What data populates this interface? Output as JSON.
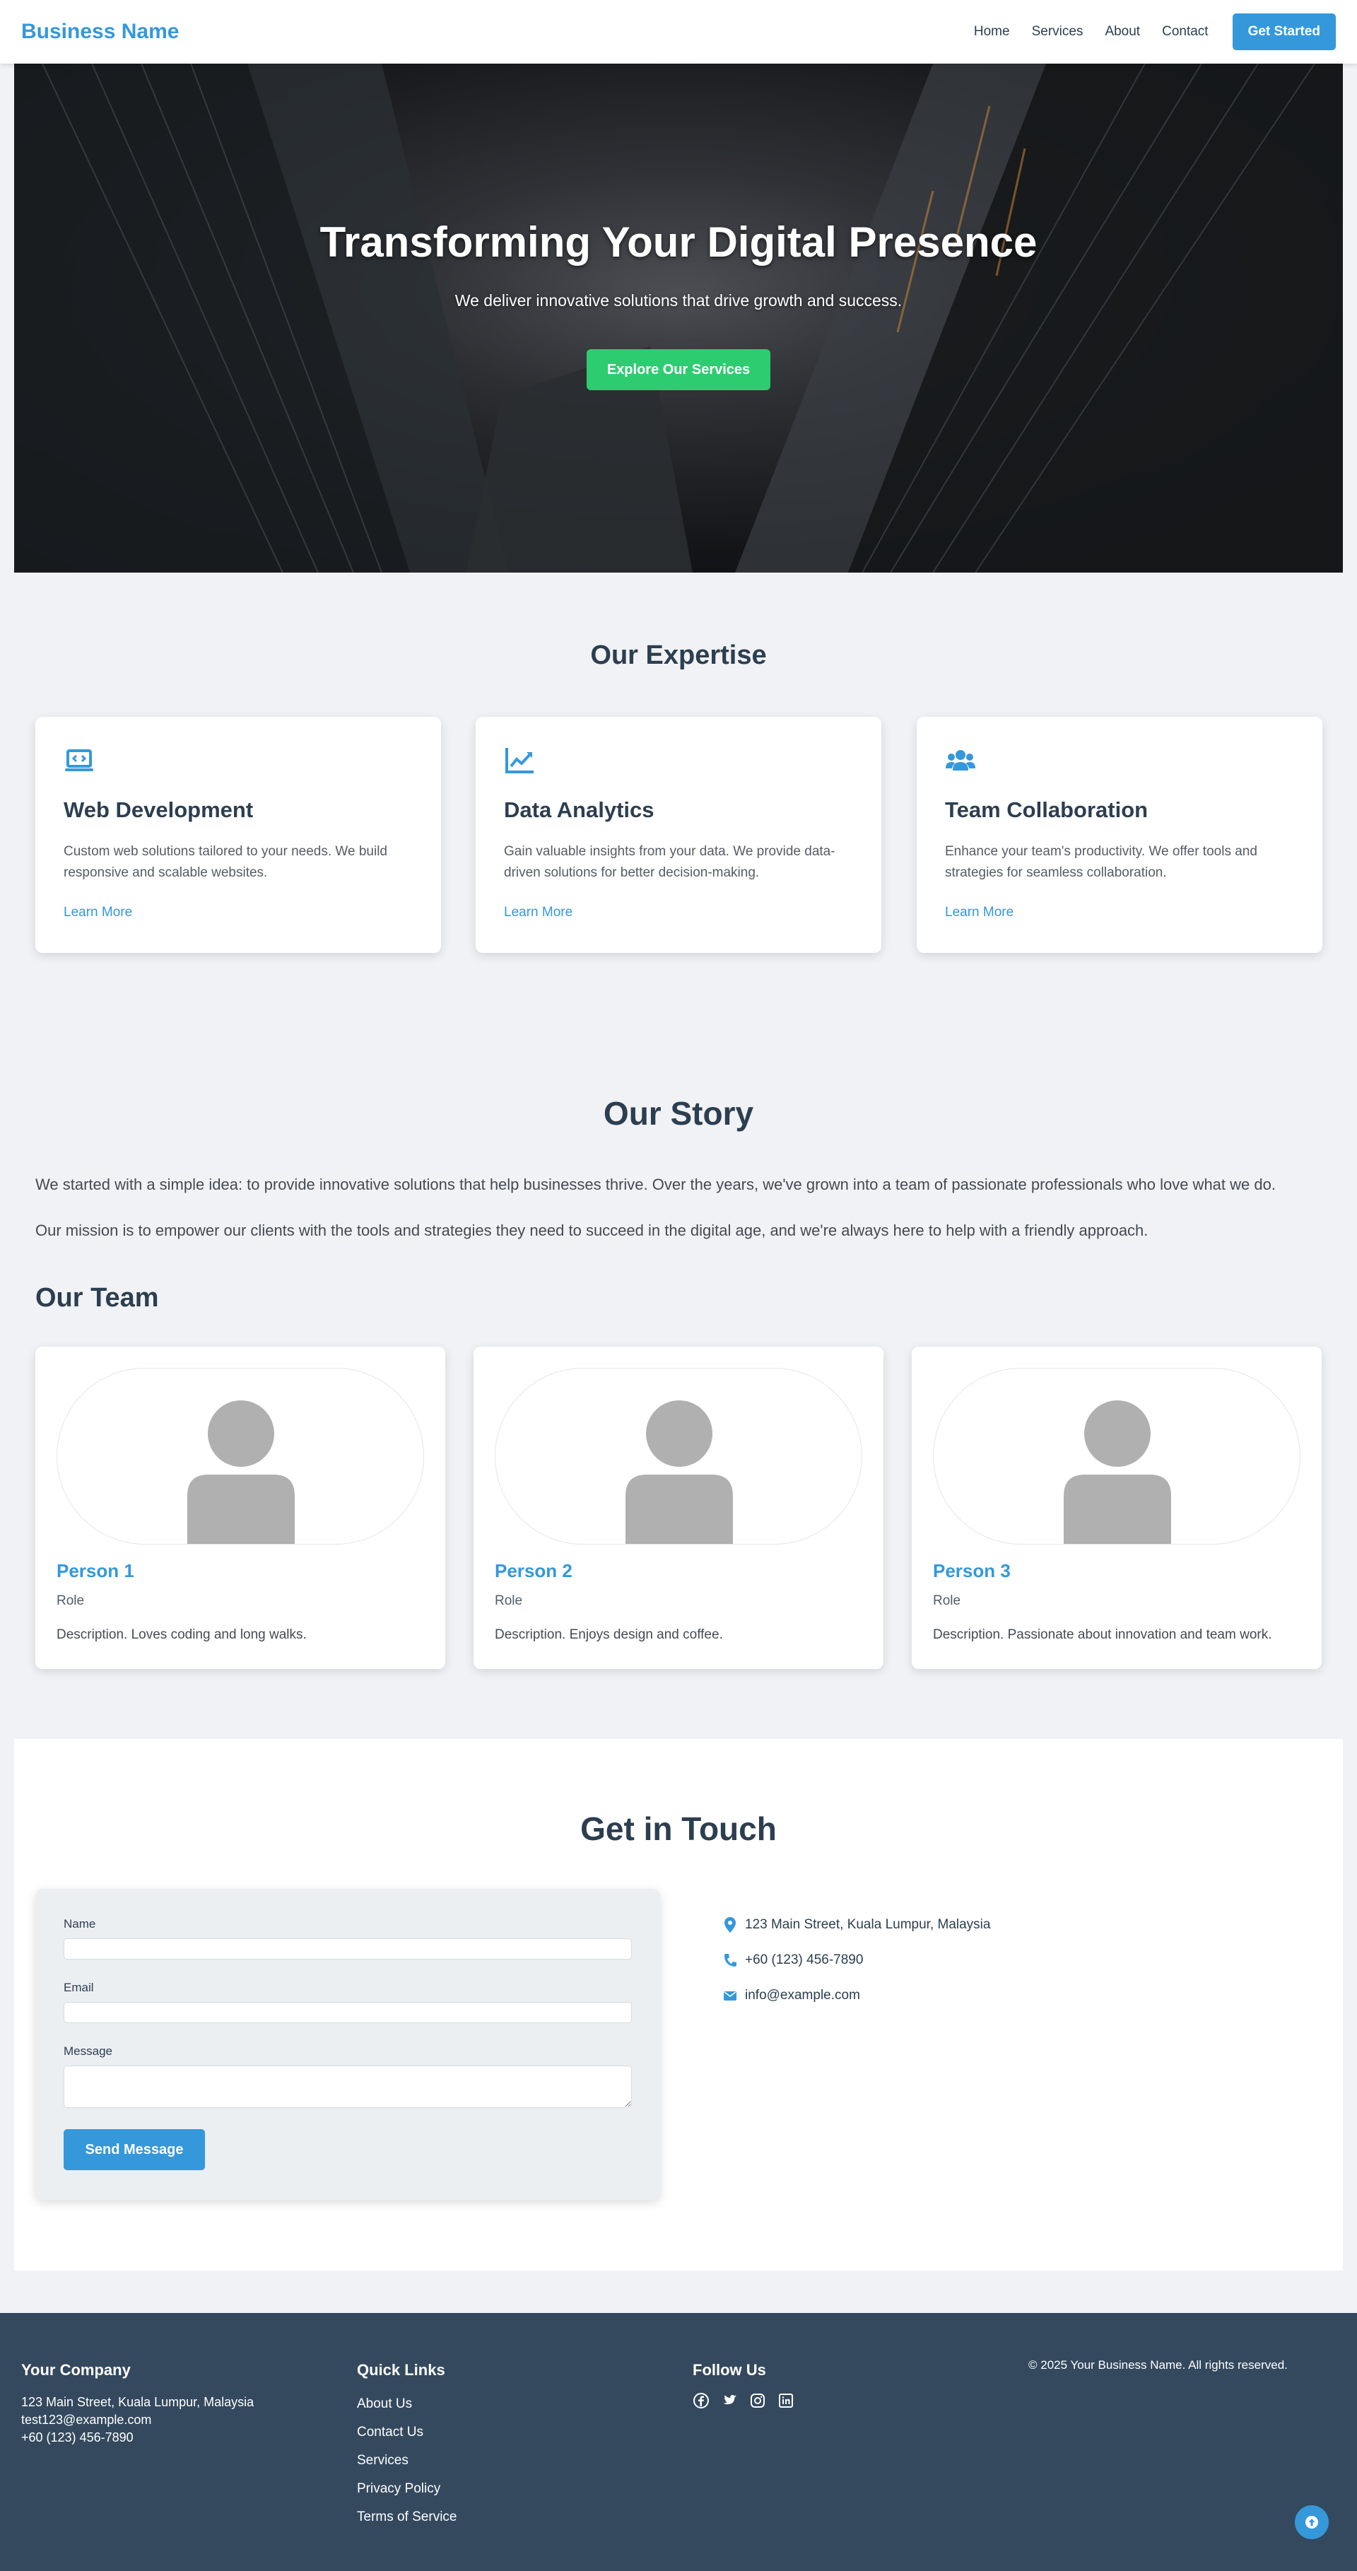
{
  "nav": {
    "brand": "Business Name",
    "links": [
      "Home",
      "Services",
      "About",
      "Contact"
    ],
    "cta": "Get Started"
  },
  "hero": {
    "title": "Transforming Your Digital Presence",
    "subtitle": "We deliver innovative solutions that drive growth and success.",
    "button": "Explore Our Services"
  },
  "expertise": {
    "title": "Our Expertise",
    "cards": [
      {
        "icon": "laptop-code-icon",
        "title": "Web Development",
        "desc": "Custom web solutions tailored to your needs. We build responsive and scalable websites.",
        "link": "Learn More"
      },
      {
        "icon": "chart-line-icon",
        "title": "Data Analytics",
        "desc": "Gain valuable insights from your data. We provide data-driven solutions for better decision-making.",
        "link": "Learn More"
      },
      {
        "icon": "users-icon",
        "title": "Team Collaboration",
        "desc": "Enhance your team's productivity. We offer tools and strategies for seamless collaboration.",
        "link": "Learn More"
      }
    ]
  },
  "story": {
    "title": "Our Story",
    "p1": "We started with a simple idea: to provide innovative solutions that help businesses thrive. Over the years, we've grown into a team of passionate professionals who love what we do.",
    "p2": "Our mission is to empower our clients with the tools and strategies they need to succeed in the digital age, and we're always here to help with a friendly approach."
  },
  "team": {
    "title": "Our Team",
    "members": [
      {
        "name": "Person 1",
        "role": "Role",
        "desc": "Description. Loves coding and long walks."
      },
      {
        "name": "Person 2",
        "role": "Role",
        "desc": "Description. Enjoys design and coffee."
      },
      {
        "name": "Person 3",
        "role": "Role",
        "desc": "Description. Passionate about innovation and team work."
      }
    ]
  },
  "contact": {
    "title": "Get in Touch",
    "form": {
      "name_label": "Name",
      "name_value": "",
      "email_label": "Email",
      "email_value": "",
      "message_label": "Message",
      "message_value": "",
      "submit": "Send Message"
    },
    "info": {
      "address": "123 Main Street, Kuala Lumpur, Malaysia",
      "phone": "+60 (123) 456-7890",
      "email": "info@example.com"
    }
  },
  "footer": {
    "company": {
      "title": "Your Company",
      "address": "123 Main Street, Kuala Lumpur, Malaysia",
      "email": "test123@example.com",
      "phone": "+60 (123) 456-7890"
    },
    "quick_links": {
      "title": "Quick Links",
      "items": [
        "About Us",
        "Contact Us",
        "Services",
        "Privacy Policy",
        "Terms of Service"
      ]
    },
    "follow": {
      "title": "Follow Us",
      "icons": [
        "facebook-icon",
        "twitter-icon",
        "instagram-icon",
        "linkedin-icon"
      ]
    },
    "copyright": "© 2025 Your Business Name. All rights reserved."
  },
  "colors": {
    "accent": "#3498db",
    "cta_green": "#2ecc71",
    "dark": "#2c3e50",
    "footer": "#34495e"
  }
}
